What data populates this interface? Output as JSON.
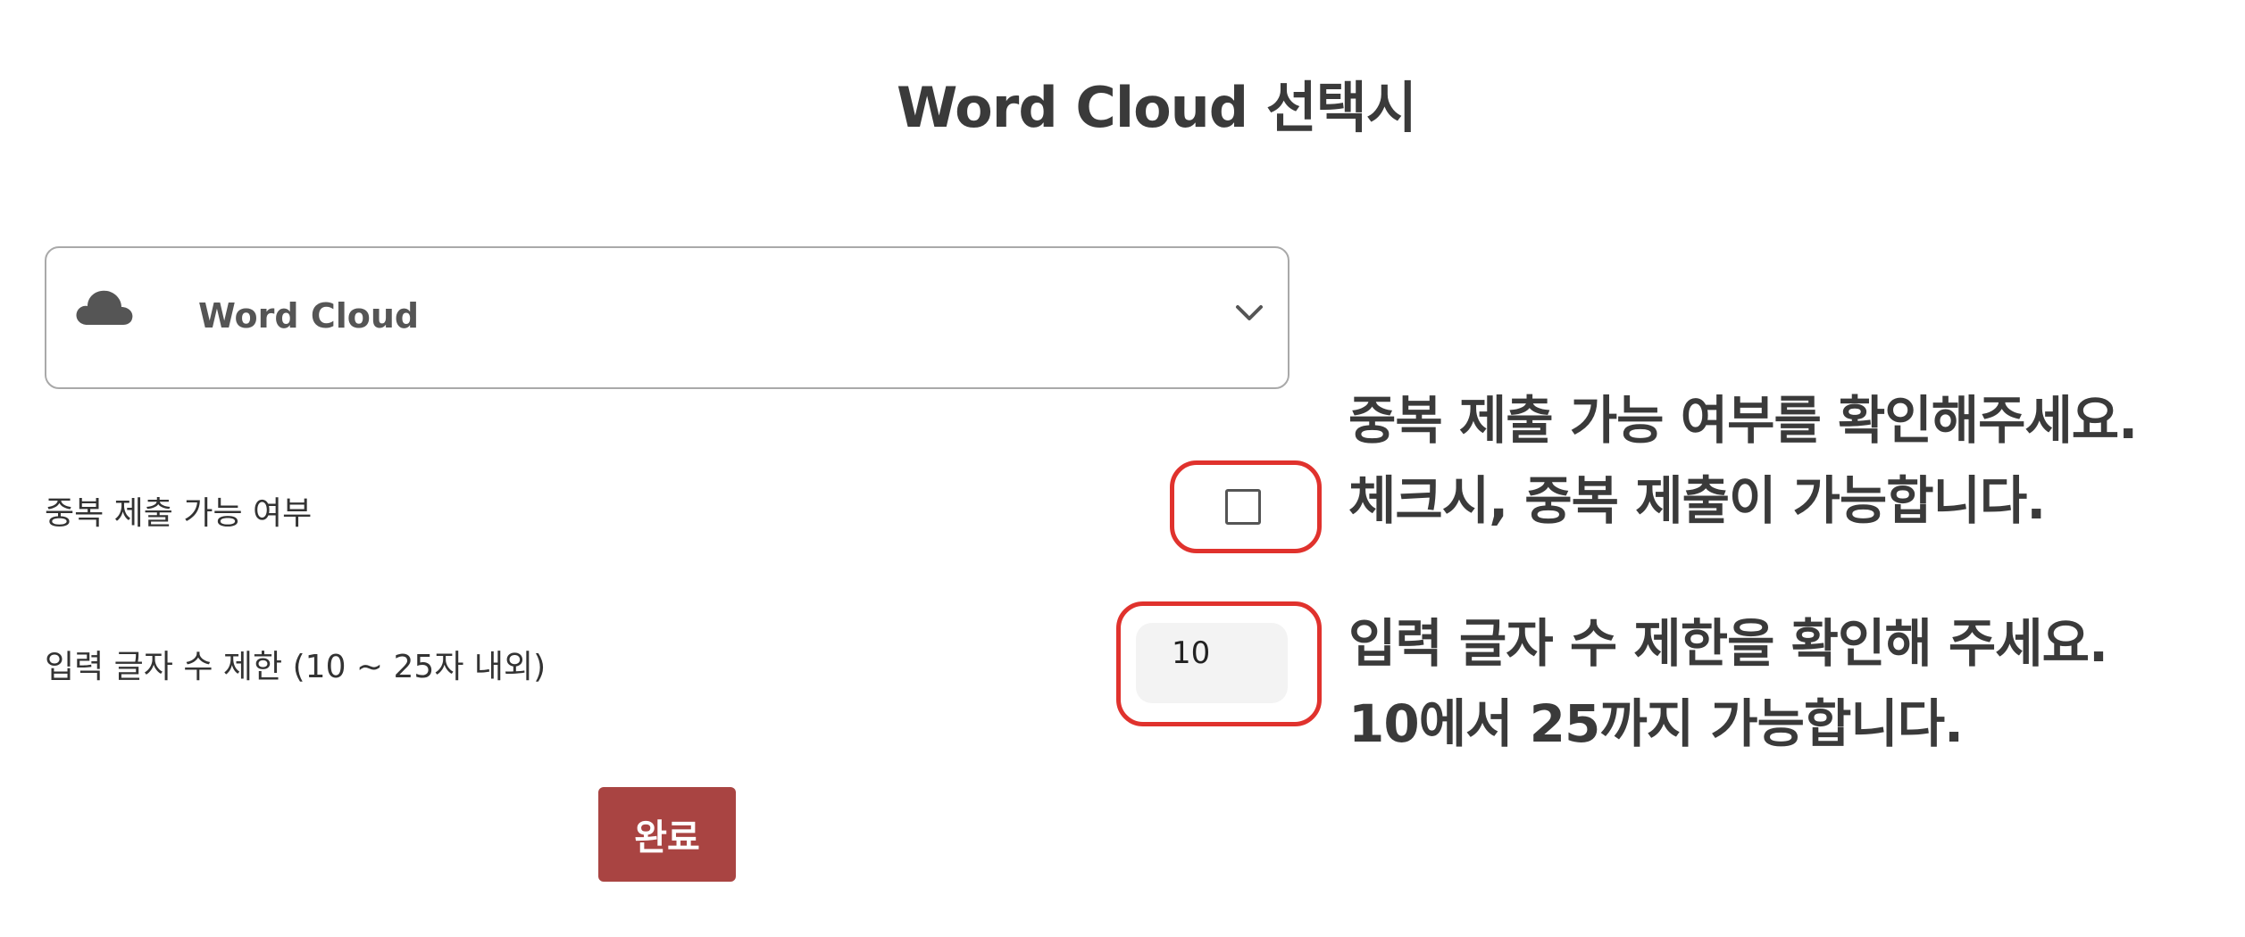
{
  "page": {
    "title": "Word Cloud 선택시"
  },
  "select": {
    "icon": "cloud-icon",
    "label": "Word Cloud",
    "chevron": "chevron-down-icon"
  },
  "form": {
    "duplicate_label": "중복 제출 가능 여부",
    "duplicate_checked": false,
    "charlimit_label": "입력 글자 수 제한 (10 ~ 25자 내외)",
    "charlimit_value": "10"
  },
  "annotations": {
    "duplicate_line1": "중복 제출 가능 여부를 확인해주세요.",
    "duplicate_line2": "체크시, 중복 제출이 가능합니다.",
    "charlimit_line1": "입력 글자 수 제한을 확인해 주세요.",
    "charlimit_line2": "10에서 25까지 가능합니다."
  },
  "buttons": {
    "done_label": "완료"
  },
  "colors": {
    "highlight": "#e0322d",
    "button": "#a94442"
  }
}
